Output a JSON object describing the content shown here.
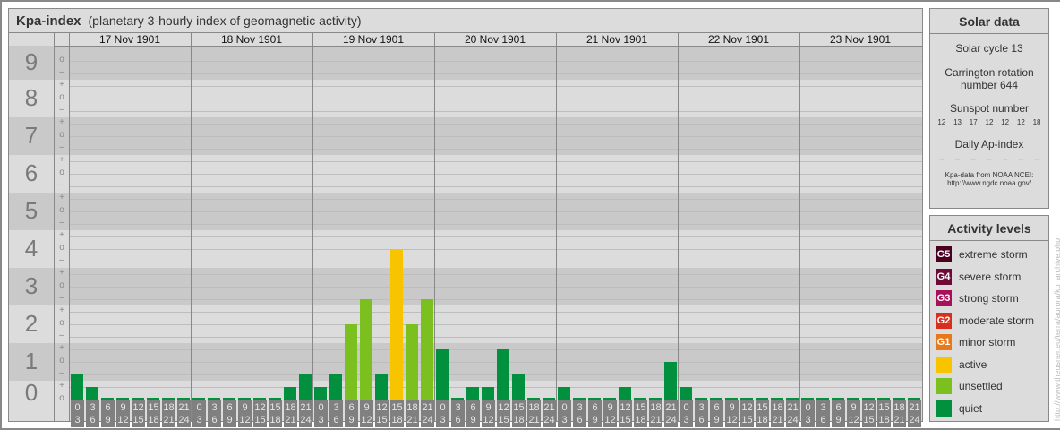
{
  "header": {
    "title": "Kpa-index",
    "subtitle": "(planetary 3-hourly index of geomagnetic activity)"
  },
  "kp_levels": [
    "0",
    "1",
    "2",
    "3",
    "4",
    "5",
    "6",
    "7",
    "8",
    "9"
  ],
  "sub_marks": {
    "plus": "+",
    "o": "o",
    "minus": "–"
  },
  "days": [
    "17 Nov 1901",
    "18 Nov 1901",
    "19 Nov 1901",
    "20 Nov 1901",
    "21 Nov 1901",
    "22 Nov 1901",
    "23 Nov 1901"
  ],
  "time_slots": [
    [
      "0",
      "3"
    ],
    [
      "3",
      "6"
    ],
    [
      "6",
      "9"
    ],
    [
      "9",
      "12"
    ],
    [
      "12",
      "15"
    ],
    [
      "15",
      "18"
    ],
    [
      "18",
      "21"
    ],
    [
      "21",
      "24"
    ]
  ],
  "kp_values": [
    [
      "1-",
      "0+",
      "0o",
      "0o",
      "0o",
      "0o",
      "0o",
      "0o"
    ],
    [
      "0o",
      "0o",
      "0o",
      "0o",
      "0o",
      "0o",
      "0+",
      "1-"
    ],
    [
      "0+",
      "1-",
      "2o",
      "3-",
      "1-",
      "4o",
      "2o",
      "3-"
    ],
    [
      "1+",
      "0o",
      "0+",
      "0+",
      "1+",
      "1-",
      "0o",
      "0o"
    ],
    [
      "0+",
      "0o",
      "0o",
      "0o",
      "0+",
      "0o",
      "0o",
      "1o"
    ],
    [
      "0+",
      "0o",
      "0o",
      "0o",
      "0o",
      "0o",
      "0o",
      "0o"
    ],
    [
      "0o",
      "0o",
      "0o",
      "0o",
      "0o",
      "0o",
      "0o",
      "0o"
    ]
  ],
  "solar": {
    "title": "Solar data",
    "cycle": "Solar cycle 13",
    "carrington_1": "Carrington rotation",
    "carrington_2": "number 644",
    "sunspot_label": "Sunspot number",
    "sunspots": [
      "12",
      "13",
      "17",
      "12",
      "12",
      "12",
      "18"
    ],
    "ap_label": "Daily Ap-index",
    "ap": [
      "--",
      "--",
      "--",
      "--",
      "--",
      "--",
      "--"
    ],
    "source_1": "Kpa-data from NOAA NCEI:",
    "source_2": "http://www.ngdc.noaa.gov/"
  },
  "activity": {
    "title": "Activity levels",
    "levels": [
      {
        "code": "G5",
        "label": "extreme storm",
        "color": "#4a0020"
      },
      {
        "code": "G4",
        "label": "severe storm",
        "color": "#6e0a3a"
      },
      {
        "code": "G3",
        "label": "strong storm",
        "color": "#a8105a"
      },
      {
        "code": "G2",
        "label": "moderate storm",
        "color": "#d8301c"
      },
      {
        "code": "G1",
        "label": "minor storm",
        "color": "#e87818"
      },
      {
        "code": "",
        "label": "active",
        "color": "#f8c400"
      },
      {
        "code": "",
        "label": "unsettled",
        "color": "#7cc020"
      },
      {
        "code": "",
        "label": "quiet",
        "color": "#00903e"
      }
    ]
  },
  "watermark": "http://www.theusner.eu/terra/aurora/kp_archive.php"
}
